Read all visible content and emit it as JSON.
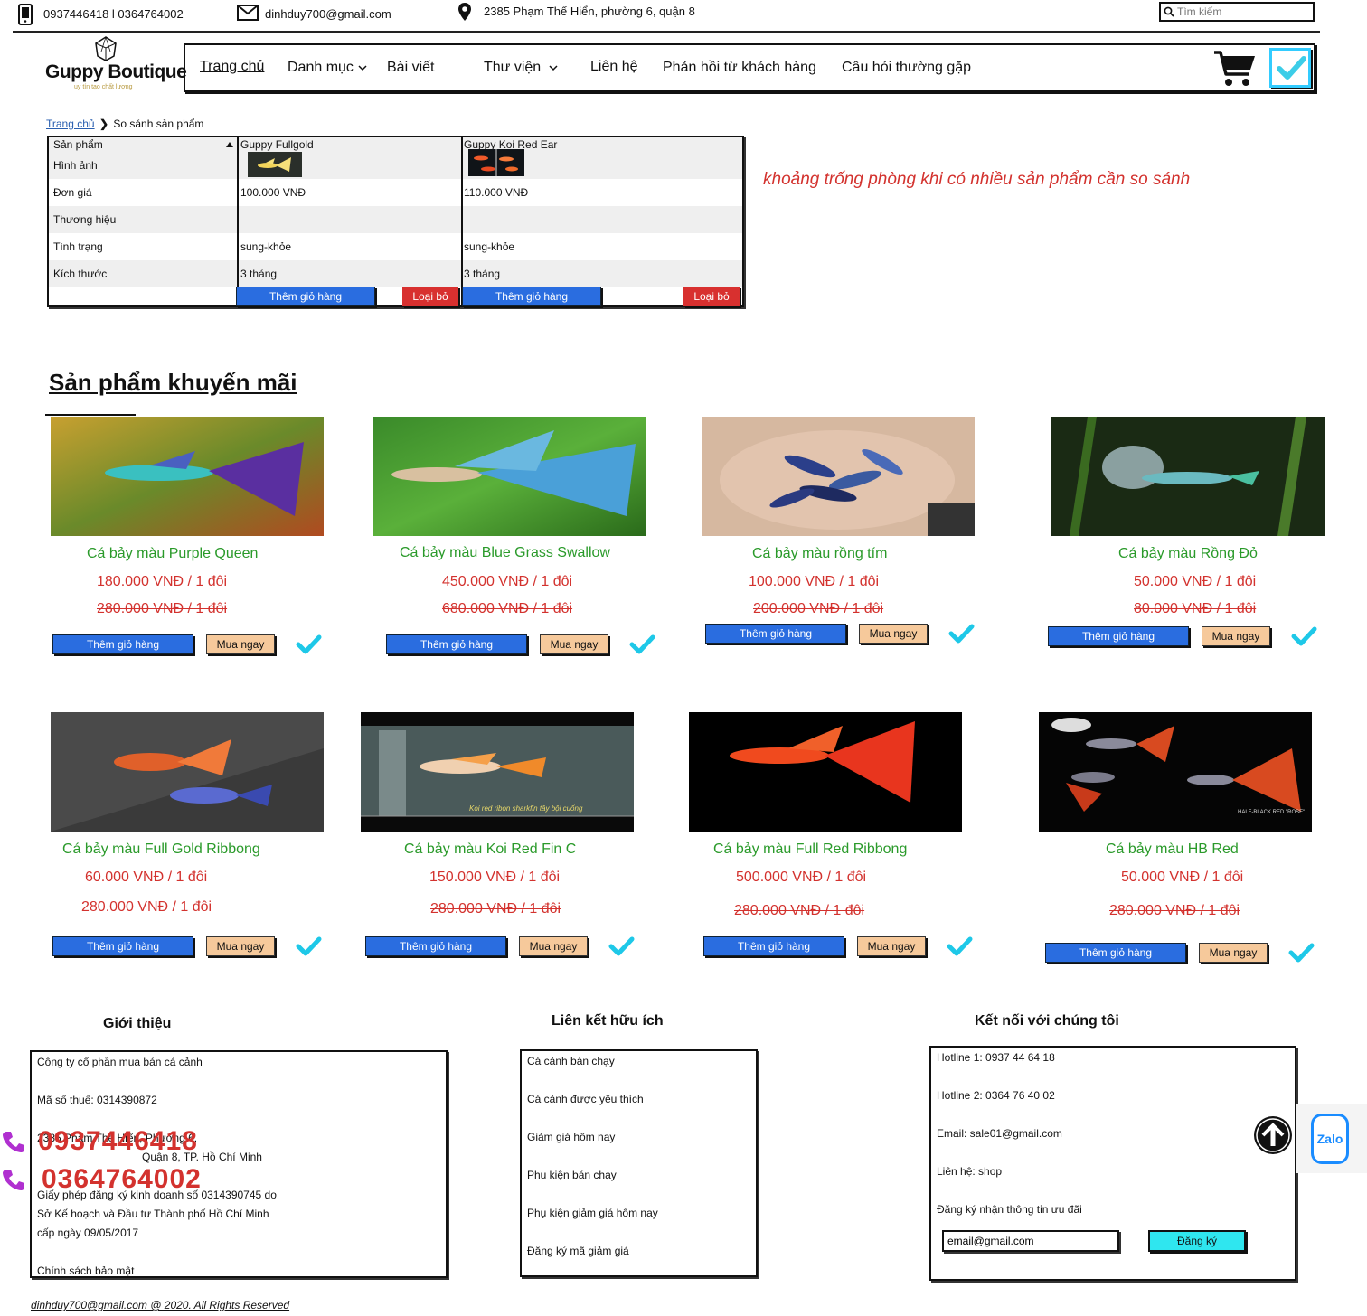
{
  "topbar": {
    "phones": "0937446418 l 0364764002",
    "email": "dinhduy700@gmail.com",
    "address": "2385 Phạm Thế Hiển, phường 6, quận 8",
    "search_placeholder": "Tìm kiếm"
  },
  "brand": {
    "name": "Guppy Boutique",
    "tagline": "uy tín tạo chất lượng"
  },
  "nav": {
    "items": [
      "Trang chủ",
      "Danh mục",
      "Bài viết",
      "Thư viện",
      "Liên hệ",
      "Phản hồi từ khách hàng",
      "Câu hỏi thường gặp"
    ]
  },
  "breadcrumb": {
    "home": "Trang chủ",
    "current": "So sánh sản phẩm"
  },
  "compare": {
    "header": "Sản phẩm",
    "row_labels": [
      "Hình ảnh",
      "Đơn giá",
      "Thương hiệu",
      "Tình trạng",
      "Kích thước"
    ],
    "products": [
      {
        "name": "Guppy Fullgold",
        "price": "100.000 VNĐ",
        "brand": "",
        "status": "sung-khỏe",
        "size": "3 tháng"
      },
      {
        "name": "Guppy Koi Red Ear",
        "price": "110.000 VNĐ",
        "brand": "",
        "status": "sung-khỏe",
        "size": "3 tháng"
      }
    ],
    "add_label": "Thêm giỏ hàng",
    "remove_label": "Loại bỏ"
  },
  "note": "khoảng trống phòng khi có nhiều sản phẩm cần so sánh",
  "promo": {
    "title": "Sản phẩm khuyến mãi",
    "add_label": "Thêm giỏ hàng",
    "buy_label": "Mua ngay",
    "products": [
      {
        "name": "Cá bảy màu Purple Queen",
        "price": "180.000 VNĐ / 1 đôi",
        "old_price": "280.000 VNĐ / 1 đôi",
        "color": "#6a3fb0"
      },
      {
        "name": "Cá bảy màu Blue Grass Swallow",
        "price": "450.000 VNĐ / 1 đôi",
        "old_price": "680.000 VNĐ / 1 đôi",
        "color": "#3a8fd0"
      },
      {
        "name": "Cá bảy màu rồng tím",
        "price": "100.000 VNĐ / 1 đôi",
        "old_price": "200.000 VNĐ / 1 đôi",
        "color": "#2b3f8a"
      },
      {
        "name": "Cá bảy màu Rồng Đỏ",
        "price": "50.000 VNĐ / 1 đôi",
        "old_price": "80.000 VNĐ / 1 đôi",
        "color": "#4fb0a0"
      },
      {
        "name": "Cá bảy màu Full Gold Ribbong",
        "price": "60.000 VNĐ / 1 đôi",
        "old_price": "280.000 VNĐ / 1 đôi",
        "color": "#e0602a"
      },
      {
        "name": "Cá bảy màu Koi Red Fin C",
        "price": "150.000 VNĐ / 1 đôi",
        "old_price": "280.000 VNĐ / 1 đôi",
        "color": "#f08a2a",
        "caption": "Koi red ribon sharkfin tây bội cuống"
      },
      {
        "name": "Cá bảy màu Full Red Ribbong",
        "price": "500.000 VNĐ / 1 đôi",
        "old_price": "280.000 VNĐ / 1 đôi",
        "color": "#e5351e"
      },
      {
        "name": "Cá bảy màu HB Red",
        "price": "50.000 VNĐ / 1 đôi",
        "old_price": "280.000 VNĐ / 1 đôi",
        "color": "#d84a20",
        "caption": "HALF-BLACK RED \"ROSE\""
      }
    ]
  },
  "footer": {
    "about": {
      "title": "Giới thiệu",
      "lines": [
        "Công ty cổ phần mua bán cá cảnh",
        "Mã số thuế: 0314390872",
        "2385 Phạm Thế Hiển, Phường 6,",
        "Quận 8, TP. Hồ Chí Minh",
        "Giấy phép đăng ký kinh doanh số 0314390745 do",
        "Sở Kế hoạch và Đầu tư Thành phố Hồ Chí Minh",
        "cấp ngày 09/05/2017",
        "Chính sách bảo mật"
      ]
    },
    "links": {
      "title": "Liên kết hữu ích",
      "items": [
        "Cá cảnh bán chạy",
        "Cá cảnh được yêu thích",
        "Giảm giá hôm nay",
        "Phụ kiện bán chạy",
        "Phụ kiện giảm giá hôm nay",
        "Đăng ký mã giảm giá"
      ]
    },
    "connect": {
      "title": "Kết nối với chúng tôi",
      "lines": [
        "Hotline 1: 0937 44 64 18",
        "Hotline 2: 0364 76 40 02",
        "Email: sale01@gmail.com",
        "Liên hệ: shop",
        "Đăng ký nhận thông tin ưu đãi"
      ],
      "email_value": "email@gmail.com",
      "subscribe_label": "Đăng ký"
    },
    "hotlines": [
      "0937446418",
      "0364764002"
    ],
    "zalo": "Zalo",
    "copyright": "dinhduy700@gmail.com @ 2020. All Rights Reserved"
  }
}
